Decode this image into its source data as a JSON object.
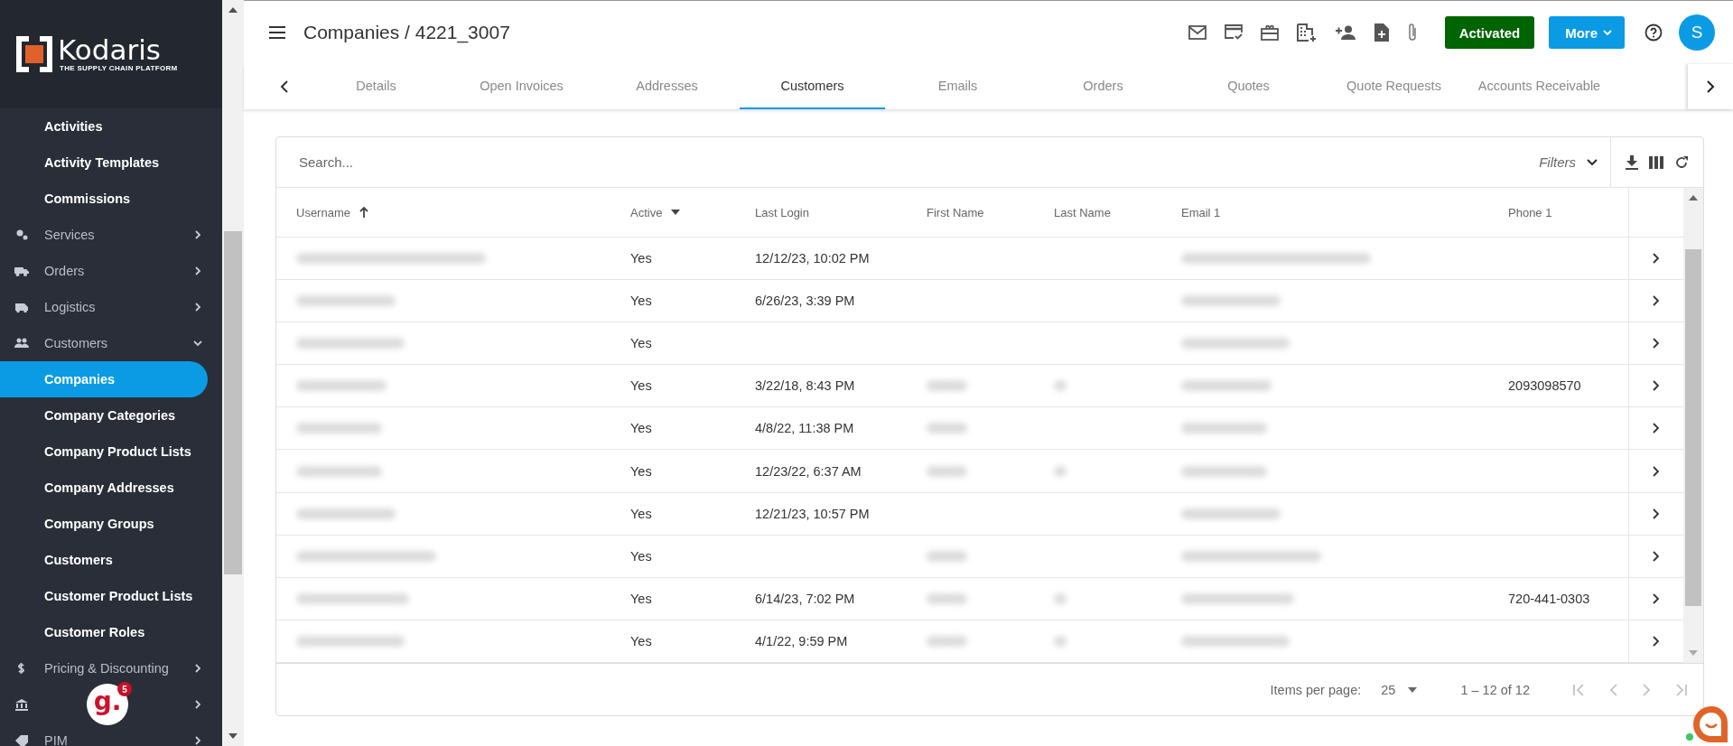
{
  "sidebar": {
    "logo": {
      "name": "Kodaris",
      "tagline": "THE SUPPLY CHAIN PLATFORM"
    },
    "items": [
      {
        "label": "Activities",
        "kind": "sub",
        "selected": false
      },
      {
        "label": "Activity Templates",
        "kind": "sub",
        "selected": false
      },
      {
        "label": "Commissions",
        "kind": "sub",
        "selected": false
      },
      {
        "label": "Services",
        "kind": "group",
        "expanded": false,
        "selected": false
      },
      {
        "label": "Orders",
        "kind": "group",
        "expanded": false,
        "selected": false
      },
      {
        "label": "Logistics",
        "kind": "group",
        "expanded": false,
        "selected": false
      },
      {
        "label": "Customers",
        "kind": "group",
        "expanded": true,
        "selected": false
      },
      {
        "label": "Companies",
        "kind": "sub",
        "selected": true
      },
      {
        "label": "Company Categories",
        "kind": "sub",
        "selected": false
      },
      {
        "label": "Company Product Lists",
        "kind": "sub",
        "selected": false
      },
      {
        "label": "Company Addresses",
        "kind": "sub",
        "selected": false
      },
      {
        "label": "Company Groups",
        "kind": "sub",
        "selected": false
      },
      {
        "label": "Customers",
        "kind": "sub",
        "selected": false
      },
      {
        "label": "Customer Product Lists",
        "kind": "sub",
        "selected": false
      },
      {
        "label": "Customer Roles",
        "kind": "sub",
        "selected": false
      },
      {
        "label": "Pricing & Discounting",
        "kind": "group",
        "expanded": false,
        "selected": false
      },
      {
        "kind": "group",
        "expanded": false,
        "selected": false
      },
      {
        "label": "PIM",
        "kind": "group",
        "expanded": false,
        "selected": false
      }
    ],
    "badge": {
      "letter": "g.",
      "count": "5"
    }
  },
  "header": {
    "title": "Companies / 4221_3007",
    "status_button": "Activated",
    "more_button": "More",
    "avatar": "S"
  },
  "tabs": [
    {
      "label": "Details",
      "selected": false
    },
    {
      "label": "Open Invoices",
      "selected": false
    },
    {
      "label": "Addresses",
      "selected": false
    },
    {
      "label": "Customers",
      "selected": true
    },
    {
      "label": "Emails",
      "selected": false
    },
    {
      "label": "Orders",
      "selected": false
    },
    {
      "label": "Quotes",
      "selected": false
    },
    {
      "label": "Quote Requests",
      "selected": false
    },
    {
      "label": "Accounts Receivable",
      "selected": false
    }
  ],
  "search": {
    "placeholder": "Search..."
  },
  "filters": "Filters",
  "table": {
    "columns": [
      {
        "label": "Username"
      },
      {
        "label": "Active"
      },
      {
        "label": "Last Login"
      },
      {
        "label": "First Name"
      },
      {
        "label": "Last Name"
      },
      {
        "label": "Email 1"
      },
      {
        "label": "Phone 1"
      }
    ],
    "rows": [
      {
        "username_redacted": true,
        "active": "Yes",
        "last_login": "12/12/23, 10:02 PM",
        "first_redacted": false,
        "last_redacted": false,
        "email_redacted": true
      },
      {
        "username_redacted": true,
        "active": "Yes",
        "last_login": "6/26/23, 3:39 PM",
        "first_redacted": false,
        "last_redacted": false,
        "email_redacted": true
      },
      {
        "username_redacted": true,
        "active": "Yes",
        "first_redacted": false,
        "last_redacted": false,
        "email_redacted": true
      },
      {
        "username_redacted": true,
        "active": "Yes",
        "last_login": "3/22/18, 8:43 PM",
        "first_redacted": true,
        "last_redacted": true,
        "email_redacted": true,
        "phone": "2093098570"
      },
      {
        "username_redacted": true,
        "active": "Yes",
        "last_login": "4/8/22, 11:38 PM",
        "first_redacted": true,
        "last_redacted": false,
        "email_redacted": true
      },
      {
        "username_redacted": true,
        "active": "Yes",
        "last_login": "12/23/22, 6:37 AM",
        "first_redacted": true,
        "last_redacted": true,
        "email_redacted": true
      },
      {
        "username_redacted": true,
        "active": "Yes",
        "last_login": "12/21/23, 10:57 PM",
        "first_redacted": false,
        "last_redacted": false,
        "email_redacted": true
      },
      {
        "username_redacted": true,
        "active": "Yes",
        "first_redacted": true,
        "last_redacted": false,
        "email_redacted": true
      },
      {
        "username_redacted": true,
        "active": "Yes",
        "last_login": "6/14/23, 7:02 PM",
        "first_redacted": true,
        "last_redacted": true,
        "email_redacted": true,
        "phone": "720-441-0303"
      },
      {
        "username_redacted": true,
        "active": "Yes",
        "last_login": "4/1/22, 9:59 PM",
        "first_redacted": true,
        "last_redacted": true,
        "email_redacted": true
      }
    ]
  },
  "paginator": {
    "label": "Items per page:",
    "page_size": "25",
    "range": "1 – 12 of 12"
  }
}
